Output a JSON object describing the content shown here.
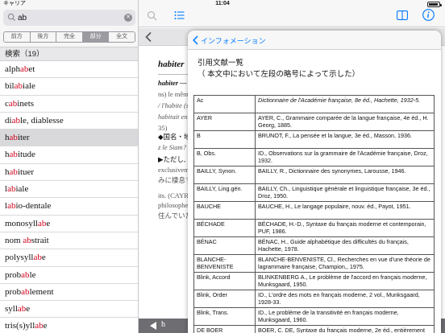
{
  "status": {
    "carrier": "キャリア",
    "time": "11:04"
  },
  "search": {
    "value": "ab"
  },
  "search_modes": [
    {
      "label": "前方"
    },
    {
      "label": "後方"
    },
    {
      "label": "完全"
    },
    {
      "label": "部分"
    },
    {
      "label": "全文"
    }
  ],
  "active_mode": "部分",
  "results": {
    "header": "検索（19）",
    "items": [
      {
        "pre": "alph",
        "hl": "ab",
        "post": "et"
      },
      {
        "pre": "bil",
        "hl": "ab",
        "post": "iale"
      },
      {
        "pre": "c",
        "hl": "ab",
        "post": "inets"
      },
      {
        "pre": "di",
        "hl": "ab",
        "post": "le, diablesse"
      },
      {
        "pre": "h",
        "hl": "ab",
        "post": "iter"
      },
      {
        "pre": "h",
        "hl": "ab",
        "post": "itude"
      },
      {
        "pre": "h",
        "hl": "ab",
        "post": "ituer"
      },
      {
        "pre": "l",
        "hl": "ab",
        "post": "iale"
      },
      {
        "pre": "l",
        "hl": "ab",
        "post": "io-dentale"
      },
      {
        "pre": "monosyll",
        "hl": "ab",
        "post": "e"
      },
      {
        "pre": "nom ",
        "hl": "ab",
        "post": "strait"
      },
      {
        "pre": "polysyll",
        "hl": "ab",
        "post": "e"
      },
      {
        "pre": "prob",
        "hl": "ab",
        "post": "le"
      },
      {
        "pre": "prob",
        "hl": "ab",
        "post": "lement"
      },
      {
        "pre": "syll",
        "hl": "ab",
        "post": "e"
      },
      {
        "pre": "tris(s)yll",
        "hl": "ab",
        "post": "e"
      }
    ],
    "selected_index": 4
  },
  "entry": {
    "title": "habiter",
    "lines": [
      "habiter — 1º",
      "ns) le mêm",
      "/ l'habite (s",
      "habitait en",
      "35)",
      "◆国名・地",
      "z le Siam?",
      "▶ただし,",
      "exclusivem",
      "みに棲息す",
      "its. (CAYR",
      "philosophe",
      "住んでいた"
    ]
  },
  "bottom_bar": {
    "word": "h",
    "right_word": "habitude"
  },
  "popover": {
    "back_label": "インフォメーション",
    "heading_line1": "引用文献一覧",
    "heading_line2": "（ 本文中において左段の略号によって示した）",
    "references": [
      {
        "abbr": "Ac",
        "desc": "Dictionnaire de l'Académie française, 8e éd., Hachette, 1932-5.",
        "italic": true
      },
      {
        "abbr": "AYER",
        "desc": "AYER, C., Grammaire comparée de la langue française, 4e éd., H. Georg, 1885."
      },
      {
        "abbr": "B",
        "desc": "BRUNOT, F., La pensée et la langue, 3e éd., Masson, 1936."
      },
      {
        "abbr": "B, Obs.",
        "desc": "ID., Observations sur la grammaire de l'Académie française, Droz, 1932."
      },
      {
        "abbr": "BAILLY, Synon.",
        "desc": "BAILLY, R., Dictionnaire des synonymes, Larousse, 1946."
      },
      {
        "abbr": "BAILLY, Ling.gén.",
        "desc": "BAILLY, Ch., Linguistique générale et linguistique française, 3e éd., Droz, 1950."
      },
      {
        "abbr": "BAUCHE",
        "desc": "BAUCHE, H., Le langage populaire, nouv. éd., Payot, 1951."
      },
      {
        "abbr": "BÉCHADE",
        "desc": "BÉCHADE, H.-D., Syntaxe du français moderne et contemporain, PUF, 1986."
      },
      {
        "abbr": "BÉNAC",
        "desc": "BÉNAC, H., Guide alphabétique des difficultés du français, Hachette, 1978."
      },
      {
        "abbr": "BLANCHE-BENVENISTE",
        "desc": "BLANCHE-BENVENISTE, Cl., Recherches en vue d'une théorie de lagrammaire française, Champion,, 1975."
      },
      {
        "abbr": "Blink, Accord",
        "desc": "BLINKENBERG A., Le problème de l'accord en français moderne, Munksgaard, 1950."
      },
      {
        "abbr": "Blink, Order",
        "desc": "ID., L'ordre des mots en français moderne, 2 vol., Munksgaard, 1928-33."
      },
      {
        "abbr": "Blink, Trans.",
        "desc": "ID., Le problème de la transitivité en français moderne, Munksgaard, 1960."
      },
      {
        "abbr": "DE BOER",
        "desc": "BOER, C. DE, Syntaxe du français moderne, 2e éd., entièrement revue, Leyde, 1954."
      }
    ]
  },
  "colors": {
    "accent": "#007aff",
    "highlight": "#d0021b",
    "bottom_bar": "#6d6d72"
  },
  "icons": [
    "search-icon",
    "list-icon",
    "book-icon",
    "info-icon",
    "chevron-left-icon"
  ]
}
